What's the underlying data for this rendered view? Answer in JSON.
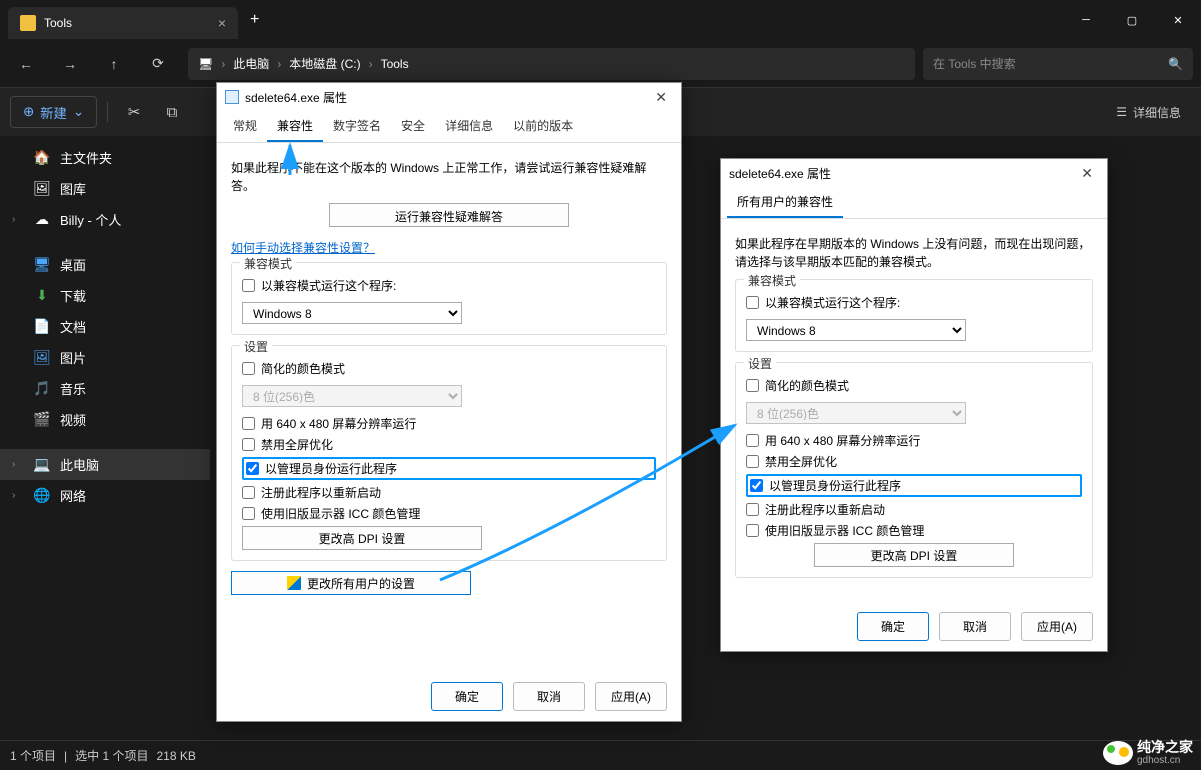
{
  "titlebar": {
    "tab_title": "Tools"
  },
  "toolbar": {
    "breadcrumb": [
      "此电脑",
      "本地磁盘 (C:)",
      "Tools"
    ],
    "search_placeholder": "在 Tools 中搜索"
  },
  "actionbar": {
    "new_label": "新建",
    "details_label": "详细信息"
  },
  "sidebar": {
    "home": "主文件夹",
    "gallery": "图库",
    "onedrive": "Billy - 个人",
    "desktop": "桌面",
    "downloads": "下载",
    "documents": "文档",
    "pictures": "图片",
    "music": "音乐",
    "videos": "视频",
    "thispc": "此电脑",
    "network": "网络"
  },
  "statusbar": {
    "items": "1 个项目",
    "selected": "选中 1 个项目",
    "size": "218 KB"
  },
  "dialog1": {
    "title": "sdelete64.exe 属性",
    "tabs": [
      "常规",
      "兼容性",
      "数字签名",
      "安全",
      "详细信息",
      "以前的版本"
    ],
    "intro": "如果此程序不能在这个版本的 Windows 上正常工作，请尝试运行兼容性疑难解答。",
    "troubleshoot_btn": "运行兼容性疑难解答",
    "manual_link": "如何手动选择兼容性设置？",
    "compat_mode_legend": "兼容模式",
    "compat_mode_check": "以兼容模式运行这个程序:",
    "compat_mode_value": "Windows 8",
    "settings_legend": "设置",
    "reduced_color": "简化的颜色模式",
    "color_value": "8 位(256)色",
    "res_640": "用 640 x 480 屏幕分辨率运行",
    "disable_fullscreen": "禁用全屏优化",
    "run_admin": "以管理员身份运行此程序",
    "register_restart": "注册此程序以重新启动",
    "legacy_icc": "使用旧版显示器 ICC 颜色管理",
    "change_dpi": "更改高 DPI 设置",
    "change_all_users": "更改所有用户的设置",
    "ok": "确定",
    "cancel": "取消",
    "apply": "应用(A)"
  },
  "dialog2": {
    "title": "sdelete64.exe 属性",
    "tab": "所有用户的兼容性",
    "intro": "如果此程序在早期版本的 Windows 上没有问题，而现在出现问题，请选择与该早期版本匹配的兼容模式。",
    "compat_mode_legend": "兼容模式",
    "compat_mode_check": "以兼容模式运行这个程序:",
    "compat_mode_value": "Windows 8",
    "settings_legend": "设置",
    "reduced_color": "简化的颜色模式",
    "color_value": "8 位(256)色",
    "res_640": "用 640 x 480 屏幕分辨率运行",
    "disable_fullscreen": "禁用全屏优化",
    "run_admin": "以管理员身份运行此程序",
    "register_restart": "注册此程序以重新启动",
    "legacy_icc": "使用旧版显示器 ICC 颜色管理",
    "change_dpi": "更改高 DPI 设置",
    "ok": "确定",
    "cancel": "取消",
    "apply": "应用(A)"
  },
  "watermark": {
    "brand": "纯净之家",
    "url": "gdhost.cn"
  }
}
